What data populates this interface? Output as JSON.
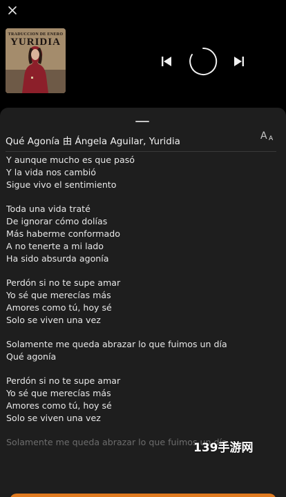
{
  "player": {
    "album": {
      "title_line1": "TRADUCCION DE ENERO",
      "title_line2": "YURIDIA"
    },
    "icons": {
      "close": "close-icon",
      "previous": "skip-previous-icon",
      "play": "loading-spinner-icon",
      "next": "skip-next-icon"
    }
  },
  "lyrics_sheet": {
    "song_title": "Qué Agonía 由 Ángela Aguilar, Yuridia",
    "font_toggle_big": "A",
    "font_toggle_small": "A",
    "stanzas": [
      [
        "Y aunque mucho es que pasó",
        "Y la vida nos cambió",
        "Sigue vivo el sentimiento"
      ],
      [
        "Toda una vida traté",
        "De ignorar cómo dolías",
        "Más haberme conformado",
        "A no tenerte a mi lado",
        "Ha sido absurda agonía"
      ],
      [
        "Perdón si no te supe amar",
        "Yo sé que merecías más",
        "Amores como tú, hoy sé",
        "Solo se viven una vez"
      ],
      [
        "Solamente me queda abrazar lo que fuimos un día",
        "Qué agonía"
      ],
      [
        "Perdón si no te supe amar",
        "Yo sé que merecías más",
        "Amores como tú, hoy sé",
        "Solo se viven una vez"
      ],
      [
        "Solamente me queda abrazar lo que fuimos un día"
      ]
    ]
  },
  "watermark": "139手游网",
  "colors": {
    "background": "#000000",
    "sheet": "#1e1e1e",
    "accent": "#e07a1f",
    "text": "#e8e8e8"
  }
}
